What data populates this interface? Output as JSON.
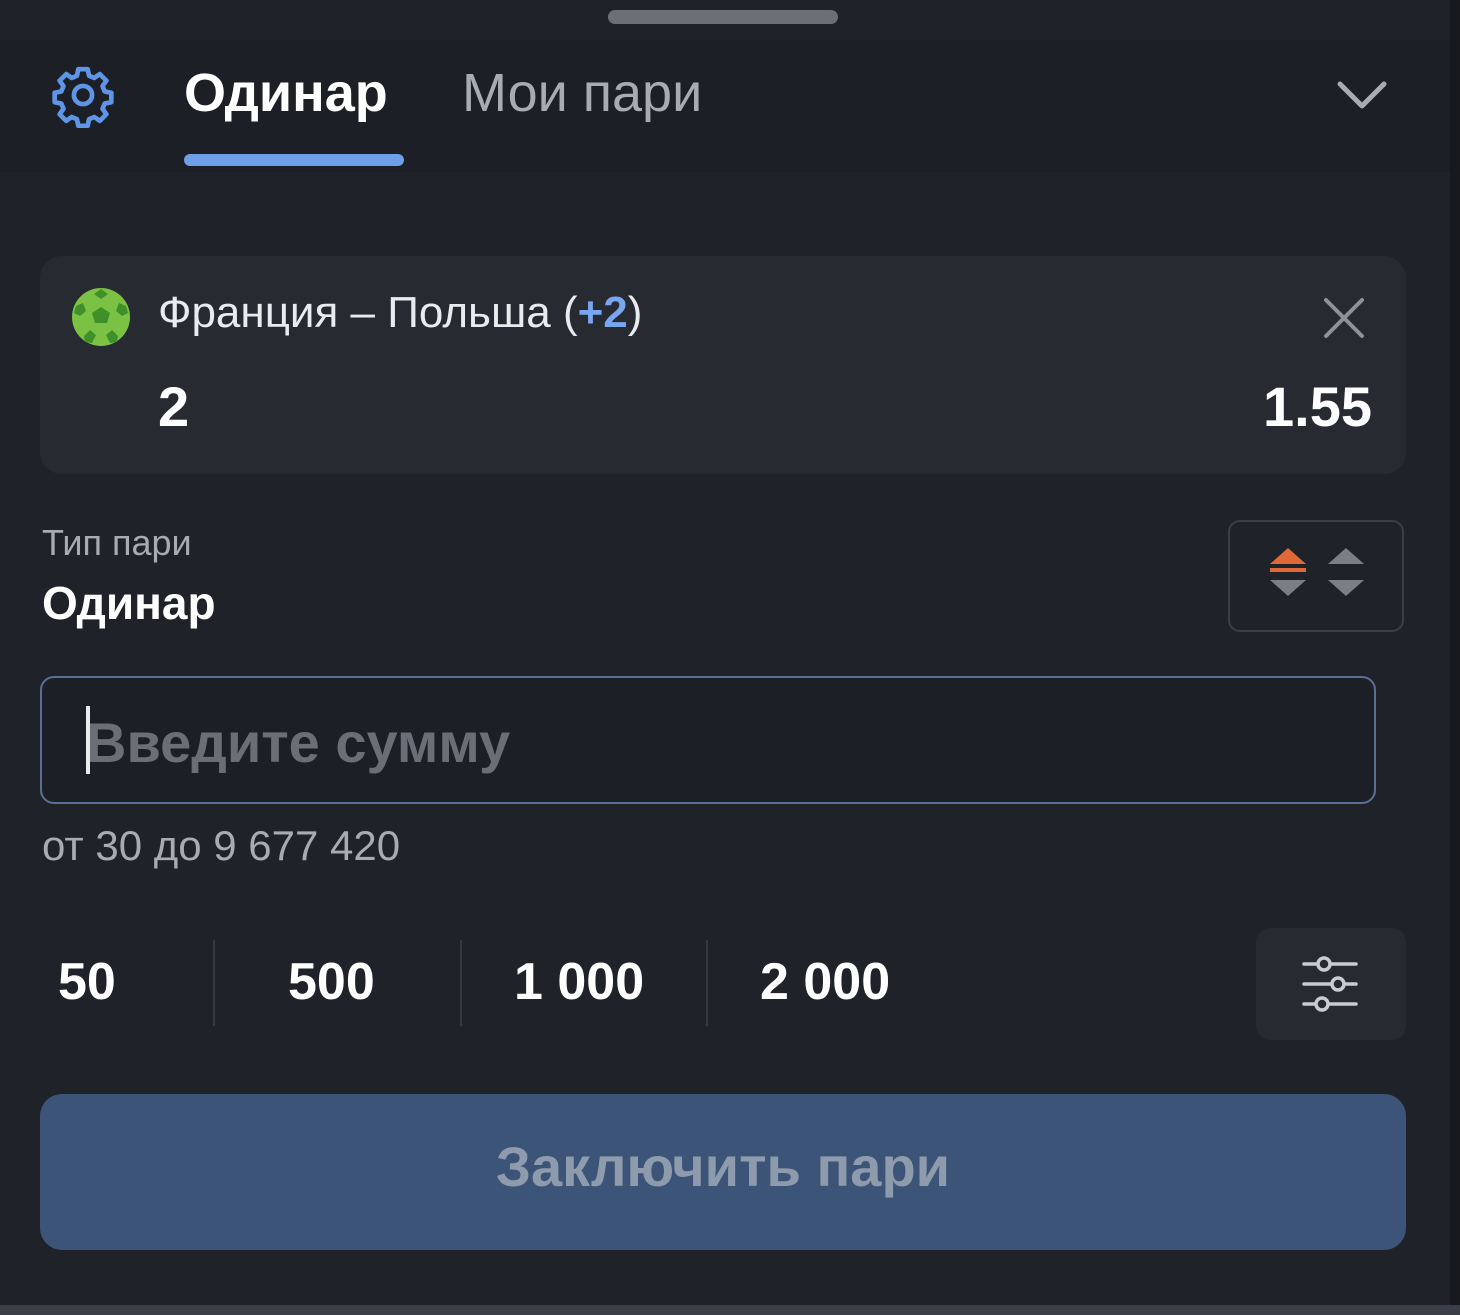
{
  "header": {
    "tabs": [
      {
        "label": "Одинар",
        "active": true
      },
      {
        "label": "Мои пари",
        "active": false
      }
    ],
    "icons": {
      "settings": "gear-icon",
      "collapse": "chevron-down-icon"
    },
    "accent_color": "#6f9fe6"
  },
  "selection": {
    "sport_icon": "soccer-ball-icon",
    "event_name": "Франция – Польша (",
    "event_extra": "+2",
    "event_close": ")",
    "outcome": "2",
    "odds": "1.55"
  },
  "bet_type": {
    "label": "Тип пари",
    "value": "Одинар",
    "toggle_icon": "odds-change-icon"
  },
  "amount": {
    "value": "",
    "placeholder": "Введите сумму",
    "range_text": "от 30 до 9 677 420"
  },
  "quick_amounts": [
    "50",
    "500",
    "1 000",
    "2 000"
  ],
  "quick_settings_icon": "sliders-icon",
  "submit": {
    "label": "Заключить пари",
    "color": "#3b5478"
  }
}
